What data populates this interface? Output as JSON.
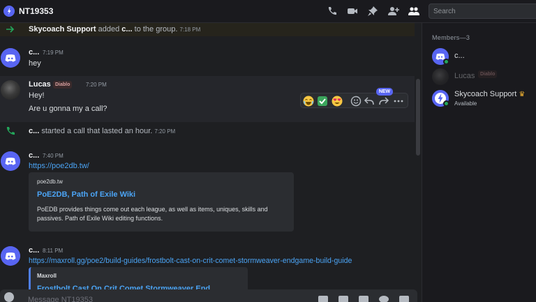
{
  "header": {
    "channel_title": "NT19353",
    "search_placeholder": "Search",
    "icons": [
      "call-icon",
      "video-icon",
      "pin-icon",
      "add-member-icon",
      "members-icon"
    ]
  },
  "system_events": {
    "added": {
      "actor": "Skycoach Support",
      "verb": " added ",
      "target": "c...",
      "suffix": " to the group.",
      "time": "7:18 PM"
    },
    "call": {
      "actor": "c...",
      "text": " started a call that lasted an hour.",
      "time": "7:20 PM"
    }
  },
  "messages": [
    {
      "author": "c...",
      "time": "7:19 PM",
      "lines": [
        "hey"
      ]
    },
    {
      "author": "Lucas",
      "tag": "Diablo",
      "time": "7:20 PM",
      "lines": [
        "Hey!",
        "Are u gonna my a call?"
      ]
    },
    {
      "author": "c...",
      "time": "7:40 PM",
      "link": "https://poe2db.tw/",
      "embed": {
        "provider": "poe2db.tw",
        "title": "PoE2DB, Path of Exile Wiki",
        "description": "PoEDB provides things come out each league, as well as items, uniques, skills and passives. Path of Exile Wiki editing functions."
      }
    },
    {
      "author": "c...",
      "time": "8:11 PM",
      "link": "https://maxroll.gg/poe2/build-guides/frostbolt-cast-on-crit-comet-stormweaver-endgame-build-guide",
      "embed": {
        "provider": "Maxroll",
        "title": "Frostbolt Cast On Crit Comet Stormweaver End..."
      }
    }
  ],
  "reaction_bar": {
    "emojis": [
      "joy-emoji",
      "check-emoji",
      "heart-eyes-emoji"
    ],
    "actions": [
      "add-reaction-icon",
      "reply-icon",
      "forward-icon",
      "more-icon"
    ],
    "new_badge": "NEW"
  },
  "composer": {
    "placeholder": "Message NT19353"
  },
  "members_panel": {
    "header": "Members—3",
    "members": [
      {
        "name": "c...",
        "status": "online"
      },
      {
        "name": "Lucas",
        "tag": "Diablo",
        "status": "offline"
      },
      {
        "name": "Skycoach Support",
        "subtext": "Available",
        "badge": "crown-icon",
        "status": "online"
      }
    ]
  },
  "colors": {
    "accent": "#5865f2",
    "link": "#4ba4f5",
    "online": "#23a55a",
    "call_icon": "#23a55a"
  }
}
